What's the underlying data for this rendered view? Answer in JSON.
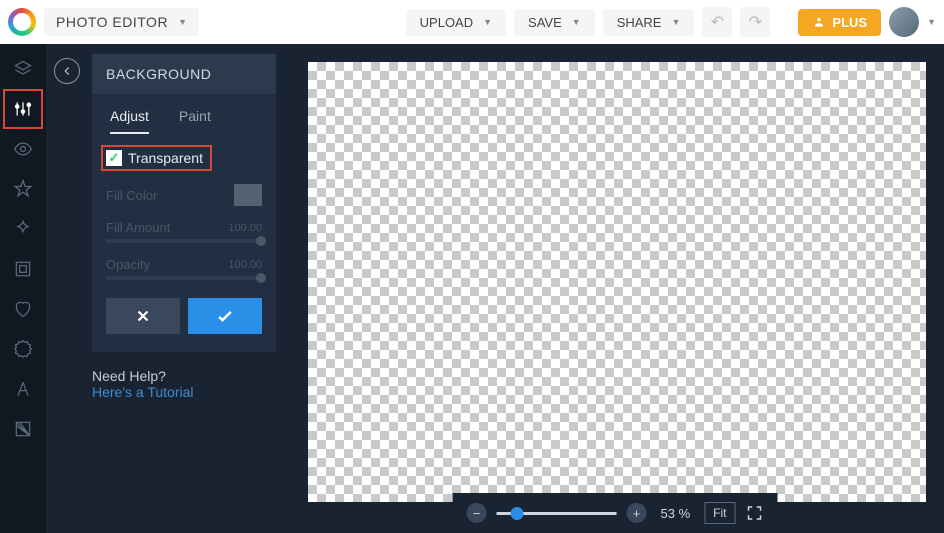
{
  "topbar": {
    "app_title": "PHOTO EDITOR",
    "upload": "UPLOAD",
    "save": "SAVE",
    "share": "SHARE",
    "plus": "PLUS"
  },
  "panel": {
    "title": "BACKGROUND",
    "tabs": {
      "adjust": "Adjust",
      "paint": "Paint"
    },
    "transparent_label": "Transparent",
    "transparent_checked": true,
    "fill_color_label": "Fill Color",
    "fill_amount_label": "Fill Amount",
    "fill_amount_value": "100.00",
    "opacity_label": "Opacity",
    "opacity_value": "100.00"
  },
  "help": {
    "question": "Need Help?",
    "link": "Here's a Tutorial"
  },
  "zoom": {
    "value": "53 %",
    "fit": "Fit"
  }
}
